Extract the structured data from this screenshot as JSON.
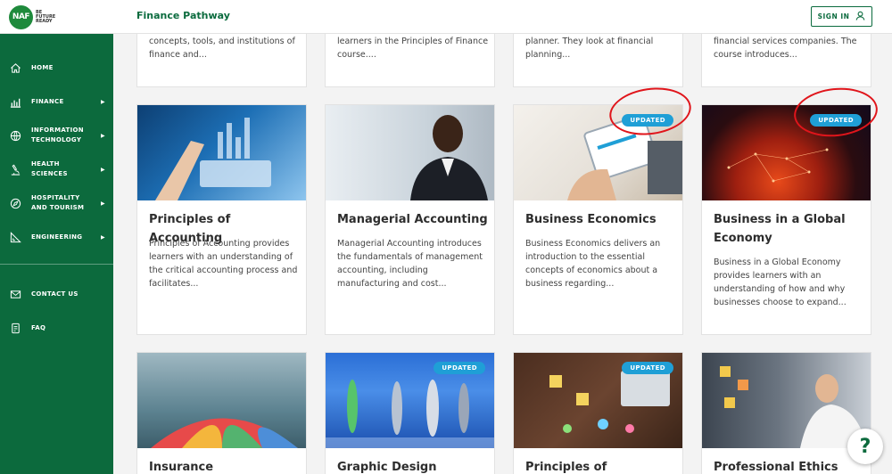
{
  "header": {
    "logo_mark": "NAF",
    "logo_tagline": "BE FUTURE READY",
    "title": "Finance Pathway",
    "signin_label": "SIGN IN"
  },
  "sidebar": {
    "items": [
      {
        "label": "HOME",
        "icon": "home-icon",
        "has_submenu": false
      },
      {
        "label": "FINANCE",
        "icon": "finance-chart-icon",
        "has_submenu": true
      },
      {
        "label": "INFORMATION TECHNOLOGY",
        "icon": "globe-icon",
        "has_submenu": true
      },
      {
        "label": "HEALTH SCIENCES",
        "icon": "microscope-icon",
        "has_submenu": true
      },
      {
        "label": "HOSPITALITY AND TOURISM",
        "icon": "compass-icon",
        "has_submenu": true
      },
      {
        "label": "ENGINEERING",
        "icon": "ruler-icon",
        "has_submenu": true
      }
    ],
    "footer_items": [
      {
        "label": "CONTACT US",
        "icon": "mail-icon"
      },
      {
        "label": "FAQ",
        "icon": "document-icon"
      }
    ]
  },
  "cards_row_top": [
    {
      "desc": "concepts, tools, and institutions of finance and..."
    },
    {
      "desc": "learners in the Principles of Finance course...."
    },
    {
      "desc": "planner. They look at financial planning..."
    },
    {
      "desc": "financial services companies. The course introduces..."
    }
  ],
  "cards_row_middle": [
    {
      "title": "Principles of Accounting",
      "desc": "Principles of Accounting provides learners with an understanding of the critical accounting process and facilitates...",
      "badge": ""
    },
    {
      "title": "Managerial Accounting",
      "desc": "Managerial Accounting introduces the fundamentals of management accounting, including manufacturing and cost...",
      "badge": ""
    },
    {
      "title": "Business Economics",
      "desc": "Business Economics delivers an introduction to the essential concepts of economics about a business regarding...",
      "badge": "UPDATED"
    },
    {
      "title": "Business in a Global Economy",
      "desc": "Business in a Global Economy provides learners with an understanding of how and why businesses choose to expand...",
      "badge": "UPDATED"
    }
  ],
  "cards_row_bottom": [
    {
      "title": "Insurance",
      "badge": ""
    },
    {
      "title": "Graphic Design",
      "badge": "UPDATED"
    },
    {
      "title": "Principles of Information",
      "badge": "UPDATED"
    },
    {
      "title": "Professional Ethics",
      "badge": ""
    }
  ],
  "help_button": "?",
  "colors": {
    "brand_green": "#0c6a3d",
    "badge_blue": "#1f9fd6",
    "annotation_red": "#e0151b"
  }
}
